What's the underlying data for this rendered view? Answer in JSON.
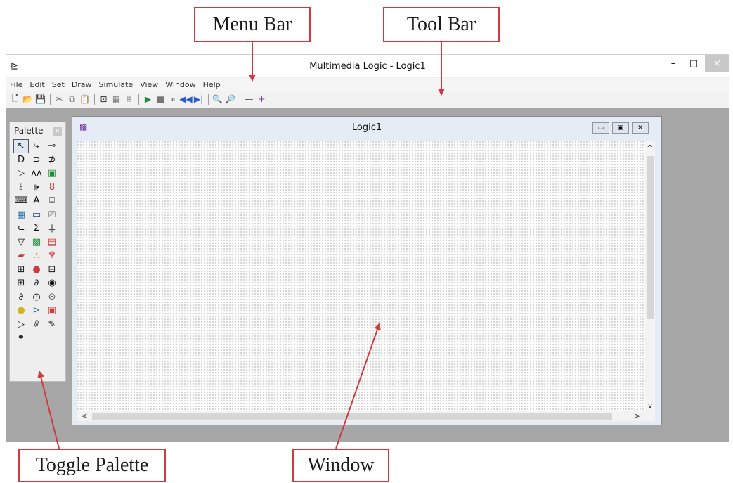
{
  "callouts": {
    "menu_bar": "Menu Bar",
    "tool_bar": "Tool Bar",
    "toggle_palette": "Toggle Palette",
    "window": "Window"
  },
  "accent_color": "#d0393f",
  "app": {
    "title": "Multimedia Logic - Logic1",
    "icon": "app-logo-icon",
    "controls": {
      "minimize": "–",
      "maximize": "□",
      "close": "×"
    }
  },
  "menu": [
    "File",
    "Edit",
    "Set",
    "Draw",
    "Simulate",
    "View",
    "Window",
    "Help"
  ],
  "toolbar": [
    {
      "name": "new-icon",
      "glyph": "🗋",
      "color": "#222"
    },
    {
      "name": "open-icon",
      "glyph": "📂",
      "color": "#c9a13c"
    },
    {
      "name": "save-icon",
      "glyph": "💾",
      "color": "#222"
    },
    {
      "sep": true
    },
    {
      "name": "cut-icon",
      "glyph": "✂",
      "color": "#666"
    },
    {
      "name": "copy-icon",
      "glyph": "⧉",
      "color": "#666"
    },
    {
      "name": "paste-icon",
      "glyph": "📋",
      "color": "#666"
    },
    {
      "sep": true
    },
    {
      "name": "draw-mode-icon",
      "glyph": "⊡",
      "color": "#333"
    },
    {
      "name": "grid-icon",
      "glyph": "▦",
      "color": "#777"
    },
    {
      "name": "align-icon",
      "glyph": "⩩",
      "color": "#777"
    },
    {
      "sep": true
    },
    {
      "name": "run-icon",
      "glyph": "▶",
      "color": "#1d8f3a"
    },
    {
      "name": "stop-icon",
      "glyph": "■",
      "color": "#777"
    },
    {
      "name": "pause-icon",
      "glyph": "⏸",
      "color": "#777"
    },
    {
      "name": "rewind-icon",
      "glyph": "◀◀",
      "color": "#2a5bd7"
    },
    {
      "name": "step-icon",
      "glyph": "▶|",
      "color": "#2a5bd7"
    },
    {
      "sep": true
    },
    {
      "name": "zoom-out-icon",
      "glyph": "🔍",
      "color": "#333"
    },
    {
      "name": "zoom-in-icon",
      "glyph": "🔎",
      "color": "#333"
    },
    {
      "sep": true
    },
    {
      "name": "minus-icon",
      "glyph": "—",
      "color": "#555"
    },
    {
      "name": "plus-icon",
      "glyph": "+",
      "color": "#7a3bb0"
    }
  ],
  "palette": {
    "title": "Palette",
    "close": "×",
    "tools": [
      {
        "name": "select-tool-icon",
        "glyph": "↖",
        "color": "#111",
        "selected": true
      },
      {
        "name": "wire-tool-icon",
        "glyph": "⤷",
        "color": "#111"
      },
      {
        "name": "pin-tool-icon",
        "glyph": "⊸",
        "color": "#111"
      },
      {
        "name": "and-gate-icon",
        "glyph": "D",
        "color": "#111"
      },
      {
        "name": "or-gate-icon",
        "glyph": "⊃",
        "color": "#111"
      },
      {
        "name": "xor-gate-icon",
        "glyph": "⊅",
        "color": "#111"
      },
      {
        "name": "buffer-icon",
        "glyph": "▷",
        "color": "#111"
      },
      {
        "name": "schmitt-icon",
        "glyph": "ᴧᴧ",
        "color": "#111"
      },
      {
        "name": "led-icon",
        "glyph": "▣",
        "color": "#1d8f3a"
      },
      {
        "name": "switch-icon",
        "glyph": "⫰",
        "color": "#111"
      },
      {
        "name": "speaker-icon",
        "glyph": "🕪",
        "color": "#111"
      },
      {
        "name": "seven-segment-icon",
        "glyph": "8",
        "color": "#d0393f"
      },
      {
        "name": "keyboard-icon",
        "glyph": "⌨",
        "color": "#111"
      },
      {
        "name": "text-icon",
        "glyph": "A",
        "color": "#111"
      },
      {
        "name": "hex-display-icon",
        "glyph": "⌸",
        "color": "#111"
      },
      {
        "name": "matrix-icon",
        "glyph": "▦",
        "color": "#1d6fa8"
      },
      {
        "name": "screen-icon",
        "glyph": "▭",
        "color": "#1d3f8f"
      },
      {
        "name": "bitmap-icon",
        "glyph": "⎚",
        "color": "#555"
      },
      {
        "name": "delay-icon",
        "glyph": "⊂",
        "color": "#111"
      },
      {
        "name": "sigma-icon",
        "glyph": "Σ",
        "color": "#111"
      },
      {
        "name": "ground-icon",
        "glyph": "⏚",
        "color": "#111"
      },
      {
        "name": "filter-icon",
        "glyph": "▽",
        "color": "#111"
      },
      {
        "name": "circuit-board-icon",
        "glyph": "▩",
        "color": "#1d8f3a"
      },
      {
        "name": "robot-icon",
        "glyph": "▤",
        "color": "#d0393f"
      },
      {
        "name": "house-icon",
        "glyph": "▰",
        "color": "#d0393f"
      },
      {
        "name": "traffic-icon",
        "glyph": "⛬",
        "color": "#c98a1d"
      },
      {
        "name": "lamp-icon",
        "glyph": "♆",
        "color": "#d0393f"
      },
      {
        "name": "flipflop-icon",
        "glyph": "⊞",
        "color": "#111"
      },
      {
        "name": "red-dot-icon",
        "glyph": "●",
        "color": "#d0393f"
      },
      {
        "name": "counter-icon",
        "glyph": "⊟",
        "color": "#111"
      },
      {
        "name": "register-icon",
        "glyph": "⊞",
        "color": "#111"
      },
      {
        "name": "oscillator-icon",
        "glyph": "∂",
        "color": "#111"
      },
      {
        "name": "globe-icon",
        "glyph": "◉",
        "color": "#111"
      },
      {
        "name": "timer-icon",
        "glyph": "∂",
        "color": "#111"
      },
      {
        "name": "clock-icon",
        "glyph": "◷",
        "color": "#111"
      },
      {
        "name": "stopwatch-icon",
        "glyph": "⏲",
        "color": "#111"
      },
      {
        "name": "lightbulb-icon",
        "glyph": "●",
        "color": "#d8b21d"
      },
      {
        "name": "bus-icon",
        "glyph": "⊳",
        "color": "#1d6fa8"
      },
      {
        "name": "picture-icon",
        "glyph": "▣",
        "color": "#d0393f"
      },
      {
        "name": "probe-icon",
        "glyph": "▷",
        "color": "#111"
      },
      {
        "name": "random-icon",
        "glyph": "⫻",
        "color": "#111"
      },
      {
        "name": "pen-icon",
        "glyph": "✎",
        "color": "#111"
      },
      {
        "name": "link-icon",
        "glyph": "⚭",
        "color": "#111"
      }
    ]
  },
  "document_window": {
    "title": "Logic1",
    "icon": "logic-doc-icon",
    "controls": {
      "minimize": "▭",
      "maximize": "▣",
      "close": "✕"
    },
    "scroll": {
      "up": "^",
      "down": "v",
      "left": "<",
      "right": ">"
    }
  }
}
